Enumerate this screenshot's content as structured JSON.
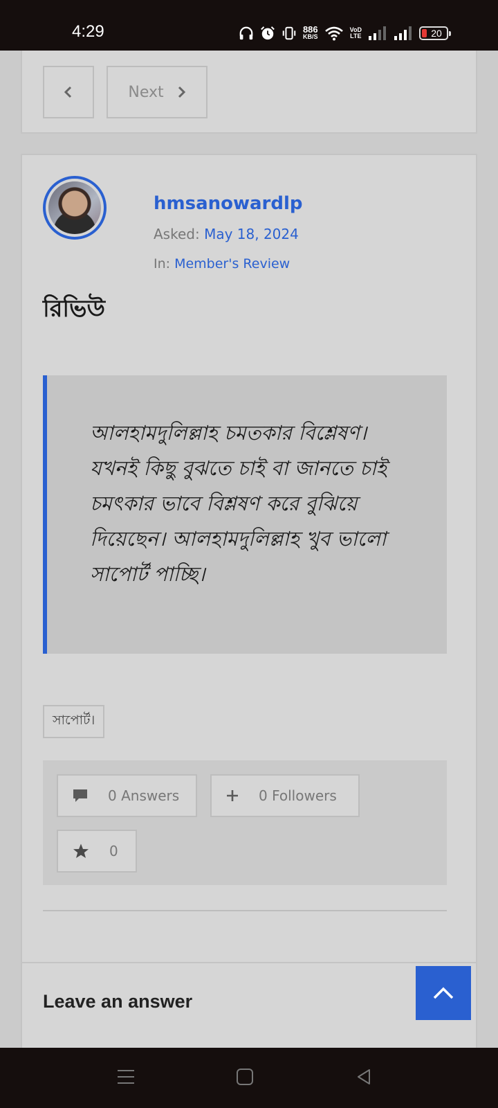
{
  "status_bar": {
    "time": "4:29",
    "net_speed_value": "886",
    "net_speed_unit": "KB/S",
    "volte_top": "VoD",
    "volte_bottom": "LTE",
    "battery": "20"
  },
  "pager": {
    "prev_label": "",
    "next_label": "Next"
  },
  "question": {
    "author": "hmsanowardlp",
    "asked_label": "Asked:",
    "asked_date": "May 18, 2024",
    "in_label": "In:",
    "category": "Member's Review",
    "title": "রিভিউ",
    "body": "আলহামদুলিল্লাহ চমতকার বিশ্লেষণ। যখনই কিছু বুঝতে চাই বা জানতে চাই চমৎকার ভাবে বিশ্লষণ করে বুঝিয়ে দিয়েছেন। আলহামদুলিল্লাহ খুব ভালো সাপোর্ট পাচ্ছি।",
    "tag": "সাপোর্ট।"
  },
  "stats": {
    "answers_count": "0",
    "answers_label": "Answers",
    "followers_count": "0",
    "followers_label": "Followers",
    "favorites_count": "0"
  },
  "answer_section": {
    "heading": "Leave an answer"
  },
  "colors": {
    "accent": "#2a60d0",
    "background": "#cbcbcb",
    "card": "#d6d6d6",
    "system_bar": "#150e0d"
  },
  "icons": {
    "prev": "chevron-left-icon",
    "next": "chevron-right-icon",
    "answers": "comment-icon",
    "followers": "plus-icon",
    "favorite": "star-icon",
    "scroll_top": "chevron-up-icon"
  }
}
